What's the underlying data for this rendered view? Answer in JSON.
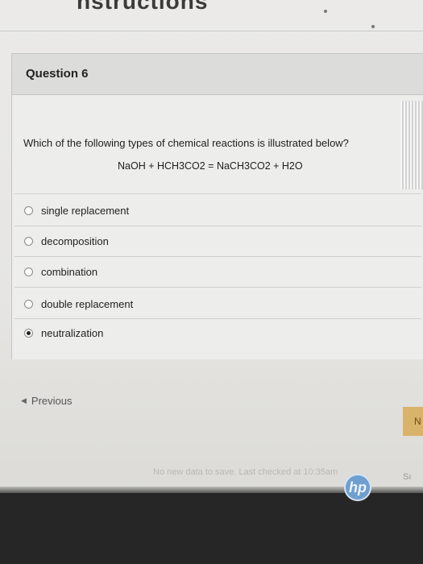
{
  "page": {
    "heading": "nstructions"
  },
  "question": {
    "title": "Question 6",
    "prompt": "Which of the following types of chemical reactions is illustrated below?",
    "equation": "NaOH + HCH3CO2 = NaCH3CO2 + H2O",
    "options": [
      {
        "label": "single replacement",
        "selected": false
      },
      {
        "label": "decomposition",
        "selected": false
      },
      {
        "label": "combination",
        "selected": false
      },
      {
        "label": "double replacement",
        "selected": false
      },
      {
        "label": "neutralization",
        "selected": true
      }
    ]
  },
  "navigation": {
    "previous_label": "Previous",
    "next_label": "N"
  },
  "footer": {
    "status": "No new data to save. Last checked at 10:35am",
    "save_label": "Sı"
  },
  "device": {
    "logo_text": "hp"
  }
}
